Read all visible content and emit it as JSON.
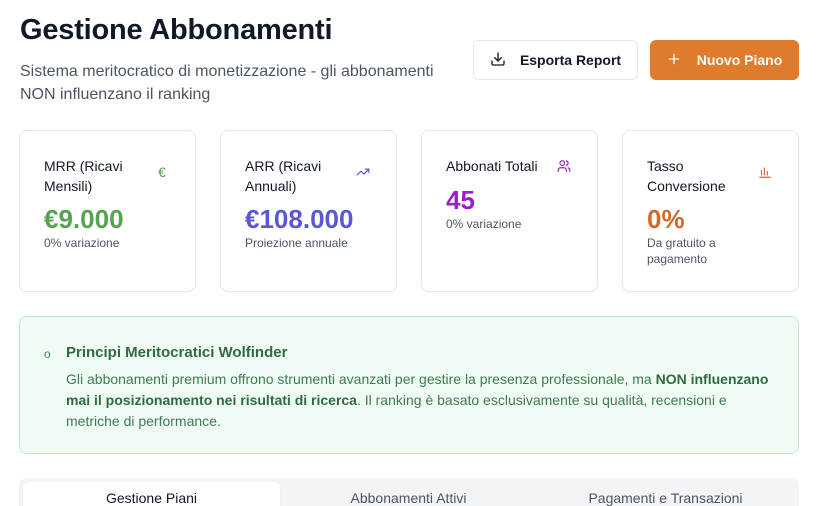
{
  "header": {
    "title": "Gestione Abbonamenti",
    "subtitle": "Sistema meritocratico di monetizzazione - gli abbonamenti NON influenzano il ranking",
    "export_label": "Esporta Report",
    "new_plan_label": "Nuovo Piano"
  },
  "stats": [
    {
      "label": "MRR (Ricavi Mensili)",
      "value": "€9.000",
      "sub": "0% variazione",
      "icon": "euro-icon",
      "icon_glyph": "€",
      "color": "#55a34f"
    },
    {
      "label": "ARR (Ricavi Annuali)",
      "value": "€108.000",
      "sub": "Proiezione annuale",
      "icon": "trending-up-icon",
      "color": "#5b55d9"
    },
    {
      "label": "Abbonati Totali",
      "value": "45",
      "sub": "0% variazione",
      "icon": "users-icon",
      "color": "#9b1fd0"
    },
    {
      "label": "Tasso Conversione",
      "value": "0%",
      "sub": "Da gratuito a pagamento",
      "icon": "bar-chart-icon",
      "color": "#d2692a"
    }
  ],
  "info": {
    "bullet": "o",
    "title": "Principi Meritocratici Wolfinder",
    "text_before": "Gli abbonamenti premium offrono strumenti avanzati per gestire la presenza professionale, ma ",
    "text_bold": "NON influenzano mai il posizionamento nei risultati di ricerca",
    "text_after": ". Il ranking è basato esclusivamente su qualità, recensioni e metriche di performance."
  },
  "tabs": [
    {
      "label": "Gestione Piani",
      "active": true
    },
    {
      "label": "Abbonamenti Attivi",
      "active": false
    },
    {
      "label": "Pagamenti e Transazioni",
      "active": false
    }
  ],
  "colors": {
    "accent": "#e07b2c",
    "info_bg": "#f0fbf3",
    "info_border": "#bfe8cb",
    "info_title": "#2f6b42"
  }
}
